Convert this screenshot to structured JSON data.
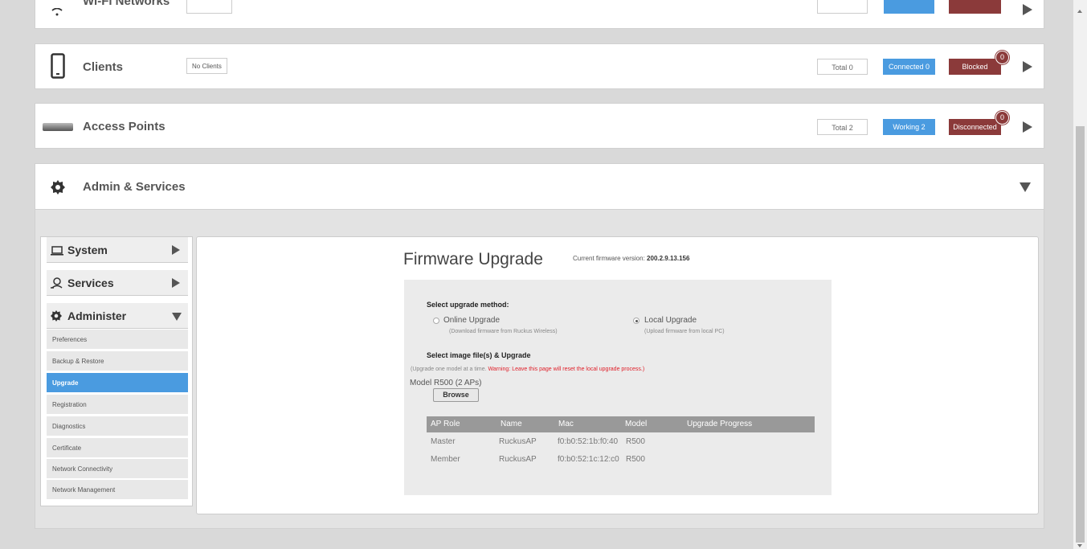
{
  "panels": {
    "wifi": {
      "title": "Wi-Fi Networks"
    },
    "clients": {
      "title": "Clients",
      "summary": "No Clients",
      "total": "Total 0",
      "connected": "Connected 0",
      "blocked": "Blocked",
      "blocked_count": "0"
    },
    "access_points": {
      "title": "Access Points",
      "total": "Total 2",
      "working": "Working 2",
      "disconnected": "Disconnected",
      "disconnected_count": "0"
    },
    "admin": {
      "title": "Admin & Services"
    }
  },
  "sidebar": {
    "system": "System",
    "services": "Services",
    "administer": "Administer",
    "items": [
      {
        "label": "Preferences"
      },
      {
        "label": "Backup & Restore"
      },
      {
        "label": "Upgrade"
      },
      {
        "label": "Registration"
      },
      {
        "label": "Diagnostics"
      },
      {
        "label": "Certificate"
      },
      {
        "label": "Network Connectivity"
      },
      {
        "label": "Network Management"
      }
    ],
    "active_item": "Upgrade"
  },
  "firmware": {
    "title": "Firmware Upgrade",
    "current_label": "Current firmware version:",
    "current_version": "200.2.9.13.156",
    "method_heading": "Select upgrade method:",
    "online_label": "Online Upgrade",
    "online_sub": "(Download firmware from Ruckus Wireless)",
    "local_label": "Local Upgrade",
    "local_sub": "(Upload firmware from local PC)",
    "selected_method": "Local Upgrade",
    "image_heading": "Select image file(s) & Upgrade",
    "note_prefix": "(Upgrade one model at a time.",
    "note_warning": "Warning: Leave this page will reset the local upgrade process.)",
    "model_label": "Model R500 (2 APs)",
    "browse_label": "Browse",
    "table": {
      "headers": [
        "AP Role",
        "Name",
        "Mac",
        "Model",
        "Upgrade Progress"
      ],
      "rows": [
        [
          "Master",
          "RuckusAP",
          "f0:b0:52:1b:f0:40",
          "R500",
          ""
        ],
        [
          "Member",
          "RuckusAP",
          "f0:b0:52:1c:12:c0",
          "R500",
          ""
        ]
      ]
    }
  },
  "colors": {
    "accent_blue": "#4a9be0",
    "blocked_red": "#8b3a3a",
    "warning_red": "#e0202a"
  }
}
